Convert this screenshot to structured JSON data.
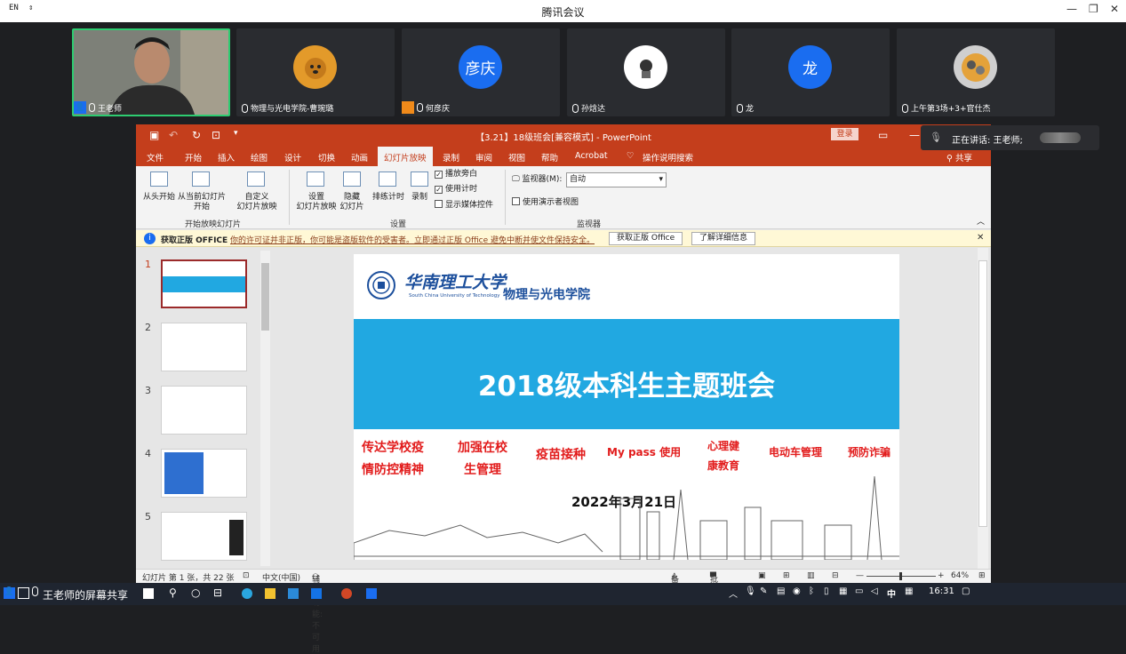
{
  "titlebar": {
    "lang": "EN",
    "title": "腾讯会议"
  },
  "participants": [
    {
      "name": "王老师",
      "initial": ""
    },
    {
      "name": "物理与光电学院-曹琬璐",
      "initial": ""
    },
    {
      "name": "何彦庆",
      "initial": "彦庆"
    },
    {
      "name": "孙焓达",
      "initial": ""
    },
    {
      "name": "龙",
      "initial": "龙"
    },
    {
      "name": "上午第3场+3+官仕杰",
      "initial": ""
    }
  ],
  "colors": {
    "accent_blue": "#1a6df0",
    "ppt_red": "#c43e1c",
    "slide_band": "#21a8e1",
    "topic_red": "#e21c1c"
  },
  "ppt": {
    "window_title": "【3.21】18级班会[兼容模式] - PowerPoint",
    "login": "登录",
    "menus": [
      "文件",
      "开始",
      "插入",
      "绘图",
      "设计",
      "切换",
      "动画",
      "幻灯片放映",
      "录制",
      "审阅",
      "视图",
      "帮助",
      "Acrobat",
      "操作说明搜索"
    ],
    "share": "共享",
    "ribbon": {
      "from_start": "从头开始",
      "from_current": "从当前幻灯片\n开始",
      "custom": "自定义\n幻灯片放映",
      "group1": "开始放映幻灯片",
      "setup": "设置\n幻灯片放映",
      "hide": "隐藏\n幻灯片",
      "rehearse": "排练计时",
      "record": "录制",
      "play_narration": "播放旁白",
      "use_timing": "使用计时",
      "show_media": "显示媒体控件",
      "group2": "设置",
      "monitor_label": "监视器(M):",
      "monitor_value": "自动",
      "presenter_view": "使用演示者视图",
      "group3": "监视器"
    },
    "notice": {
      "title": "获取正版 OFFICE",
      "message": "你的许可证并非正版，你可能是盗版软件的受害者。立即通过正版 Office 避免中断并使文件保持安全。",
      "btn1": "获取正版 Office",
      "btn2": "了解详细信息"
    },
    "thumb_numbers": [
      "1",
      "2",
      "3",
      "4",
      "5"
    ],
    "slide": {
      "school_cn": "华南理工大学",
      "school_en": "South China University of Technology",
      "college": "物理与光电学院",
      "title": "2018级本科生主题班会",
      "topics": [
        "传达学校疫情防控精神",
        "加强在校生管理",
        "疫苗接种",
        "My pass 使用",
        "心理健康教育",
        "电动车管理",
        "预防诈骗"
      ],
      "date": "2022年3月21日"
    },
    "status": {
      "slide_count": "幻灯片 第 1 张，共 22 张",
      "language": "中文(中国)",
      "accessibility": "辅助功能: 不可用",
      "notes": "备注",
      "comments": "批注",
      "zoom": "64%"
    }
  },
  "speaking": {
    "label": "正在讲话: 王老师;"
  },
  "taskbar": {
    "share_label": "王老师的屏幕共享",
    "ime": "中",
    "time": "16:31"
  }
}
